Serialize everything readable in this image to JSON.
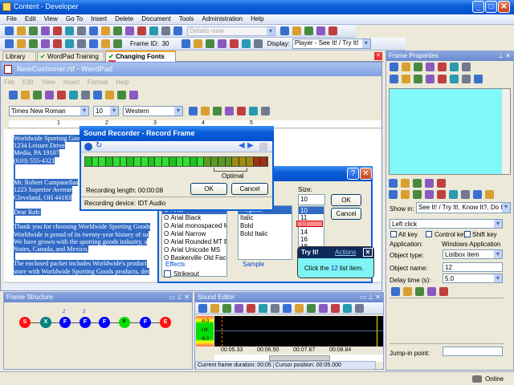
{
  "app": {
    "title": "Content - Developer"
  },
  "menu": [
    "File",
    "Edit",
    "View",
    "Go To",
    "Insert",
    "Delete",
    "Document",
    "Tools",
    "Administration",
    "Help"
  ],
  "toolbar1": {
    "icons": [
      "open-icon",
      "save-icon",
      "print-icon",
      "cut-icon",
      "copy-icon",
      "paste-icon",
      "delete-icon",
      "properties-icon",
      "undo-icon",
      "redo-icon",
      "move-up-icon",
      "move-down-icon",
      "find-icon",
      "replace-icon",
      "help-icon"
    ],
    "view_select": "Details view",
    "view_icons": [
      "details-view-icon",
      "split-horizontal-icon",
      "split-vertical-icon",
      "options-icon",
      "refresh-icon"
    ]
  },
  "toolbar2": {
    "icons": [
      "shield-icon",
      "add-frame-icon",
      "remove-frame-icon",
      "branch-icon",
      "link-icon",
      "unlink-icon",
      "edit-icon",
      "capture-icon",
      "frame-icon",
      "frame-next-icon"
    ],
    "frame_id_label": "Frame ID:",
    "frame_id": "30",
    "nav_icons": [
      "first-icon",
      "prev-icon",
      "next-icon",
      "last-icon",
      "tree-icon",
      "indent-icon",
      "outdent-icon"
    ],
    "display_label": "Display:",
    "display_value": "Player - See It! / Try It!"
  },
  "tabs": [
    {
      "label": "Library"
    },
    {
      "label": "WordPad Training"
    },
    {
      "label": "Changing Fonts"
    }
  ],
  "wordpad": {
    "title": "NewCustomer.rtf - WordPad",
    "menu": [
      "File",
      "Edit",
      "View",
      "Insert",
      "Format",
      "Help"
    ],
    "toolbar_icons": [
      "new-icon",
      "open-icon",
      "save-icon",
      "print-icon",
      "print-preview-icon",
      "find-icon",
      "cut-icon",
      "copy-icon",
      "paste-icon",
      "undo-icon",
      "datetime-icon"
    ],
    "font": "Times New Roman",
    "size": "10",
    "script": "Western",
    "format_icons": [
      "bold-icon",
      "italic-icon",
      "underline-icon",
      "color-icon",
      "align-left-icon",
      "align-center-icon",
      "align-right-icon"
    ],
    "ruler": [
      "1",
      "2",
      "3",
      "4",
      "5"
    ],
    "lines": [
      "Worldwide Sporting Goo",
      "1234 Leisure Drive",
      "Media, PA 19107",
      "(610) 555-4321",
      "",
      "",
      "Mr. Robert Campanellas",
      "1223 Superior Avenue",
      "Cleveland, OH  44183",
      "",
      "Dear Rob:",
      "",
      "Thank you for choosing Worldwide Sporting Goods",
      "Worldwide is proud of its twenty-year history of su",
      "We have grown with the sporting goods industry, a",
      "States, Canada, and Mexico.",
      "",
      "The enclosed packet includes Worldwide's product",
      "store with Worldwide Sporting Goods products, det"
    ]
  },
  "font_dialog": {
    "help": "?",
    "size_label": "Size:",
    "size_value": "10",
    "fonts": [
      "Arial",
      "Arial Black",
      "Arial monospaced for S",
      "Arial Narrow",
      "Arial Rounded MT Bol",
      "Arial Unicode MS",
      "Baskerville Old Face"
    ],
    "styles": [
      "Regular",
      "Italic",
      "Bold",
      "Bold Italic"
    ],
    "sizes": [
      "10",
      "11",
      "12",
      "14",
      "16",
      "18"
    ],
    "ok": "OK",
    "cancel": "Cancel",
    "effects": "Effects",
    "strikeout": "Strikeout",
    "sample": "Sample"
  },
  "sound_recorder": {
    "title": "Sound Recorder - Record Frame",
    "optimal": "Optimal",
    "length": "Recording length: 00:00:08",
    "ok": "OK",
    "cancel": "Cancel",
    "device": "Recording device: IDT Audio",
    "level": 0.62
  },
  "callout": {
    "title": "Try It!",
    "actions": "Actions",
    "text_pre": "Click the ",
    "text_item": "12",
    "text_post": " list item."
  },
  "frame_properties": {
    "title": "Frame Properties",
    "edit_icons": [
      "cut-icon",
      "copy-icon",
      "paste-icon",
      "delete-icon",
      "font-icon",
      "insert-field-icon",
      "link-icon"
    ],
    "format_icons": [
      "align-left-icon",
      "align-center-icon",
      "align-right-icon",
      "justify-icon",
      "bold-icon",
      "italic-icon",
      "underline-icon",
      "text-color-icon"
    ],
    "row1_icons": [
      "hand-icon",
      "edit-note-icon",
      "frame-icon",
      "frame-edit-icon",
      "frame-sound-icon"
    ],
    "row2_icons": [
      "check-icon",
      "list-icon",
      "hand-icon",
      "paint-icon",
      "copy-frame-icon",
      "next-frame-icon",
      "frame-red-icon",
      "frame-down-icon",
      "font-a-icon"
    ],
    "show_in_label": "Show in:",
    "show_in": "See It! / Try It!, Know It?, Do It!",
    "action": "Left click",
    "alt": "Alt key",
    "ctrl": "Control key",
    "shift": "Shift key",
    "app_label": "Application:",
    "app_value": "Windows Application",
    "objtype_label": "Object type:",
    "objtype": "Listbox item",
    "objname_label": "Object name:",
    "objname": "12",
    "delay_label": "Delay time (s):",
    "delay": "5.0",
    "tool_icons": [
      "select-region-icon",
      "highlight-box-icon",
      "user-icon",
      "recorder-icon",
      "key-icon"
    ],
    "jump_label": "Jump-in point:",
    "jump": ""
  },
  "frame_structure": {
    "title": "Frame Structure",
    "nodes": [
      {
        "l": "S",
        "c": "#ff1010"
      },
      {
        "l": "X",
        "c": "#008080"
      },
      {
        "l": "F",
        "c": "#0000ff",
        "n": "2"
      },
      {
        "l": "F",
        "c": "#0000ff",
        "n": "2"
      },
      {
        "l": "F",
        "c": "#0000ff"
      },
      {
        "l": "F",
        "c": "#00e000"
      },
      {
        "l": "F",
        "c": "#0000ff"
      },
      {
        "l": "E",
        "c": "#ff1010"
      }
    ]
  },
  "sound_editor": {
    "title": "Sound Editor",
    "icons": [
      "import-icon",
      "export-icon",
      "record-icon",
      "mic-icon",
      "play-icon",
      "play-selection-icon",
      "stop-icon",
      "cut-icon",
      "copy-icon",
      "paste-icon",
      "delete-icon",
      "fit-icon",
      "grid-icon",
      "trim-icon"
    ],
    "db": [
      "-6.0",
      "-Inf.",
      "-6.0"
    ],
    "times": [
      "00:05.33",
      "00:06.50",
      "00:07.67",
      "00:08.84"
    ],
    "duration": "Current frame duration: 00:05",
    "cursor": "Cursor position: 00:05.000"
  },
  "status": {
    "online": "Online"
  }
}
